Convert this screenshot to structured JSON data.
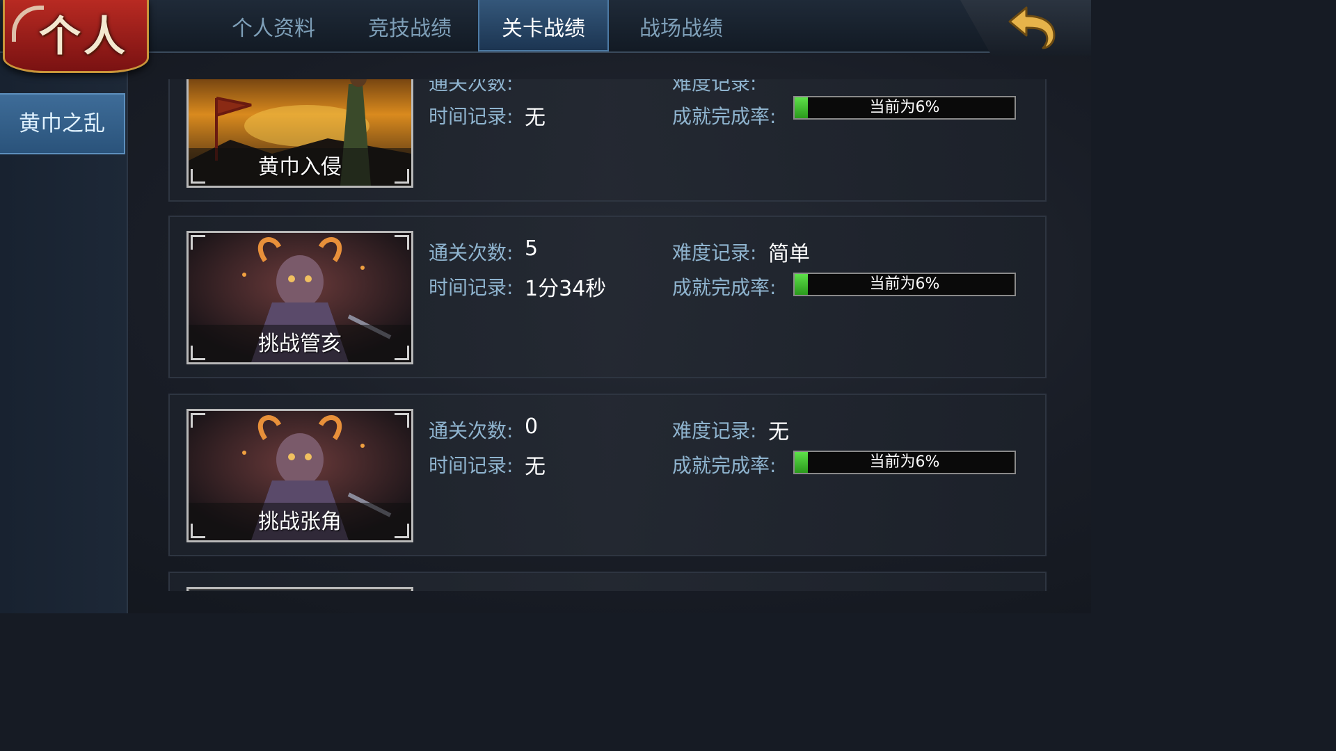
{
  "header": {
    "title": "个人",
    "tabs": [
      {
        "label": "个人资料",
        "active": false
      },
      {
        "label": "竞技战绩",
        "active": false
      },
      {
        "label": "关卡战绩",
        "active": true
      },
      {
        "label": "战场战绩",
        "active": false
      }
    ],
    "back_icon": "back-arrow-icon"
  },
  "sidebar": {
    "items": [
      {
        "label": "黄巾之乱",
        "selected": true
      }
    ]
  },
  "labels": {
    "clears": "通关次数:",
    "difficulty": "难度记录:",
    "time": "时间记录:",
    "achievement": "成就完成率:"
  },
  "stages": [
    {
      "name": "黄巾入侵",
      "clears": "",
      "difficulty": "",
      "time": "无",
      "progress_text": "当前为6%",
      "progress": 0.06,
      "art": "battlefield"
    },
    {
      "name": "挑战管亥",
      "clears": "5",
      "difficulty": "简单",
      "time": "1分34秒",
      "progress_text": "当前为6%",
      "progress": 0.06,
      "art": "demon"
    },
    {
      "name": "挑战张角",
      "clears": "0",
      "difficulty": "无",
      "time": "无",
      "progress_text": "当前为6%",
      "progress": 0.06,
      "art": "demon"
    }
  ],
  "colors": {
    "accent": "#3e6c98",
    "progress_green": "#4fd03a",
    "label_blue": "#8fb4cf",
    "emblem_red": "#9e1e18"
  }
}
